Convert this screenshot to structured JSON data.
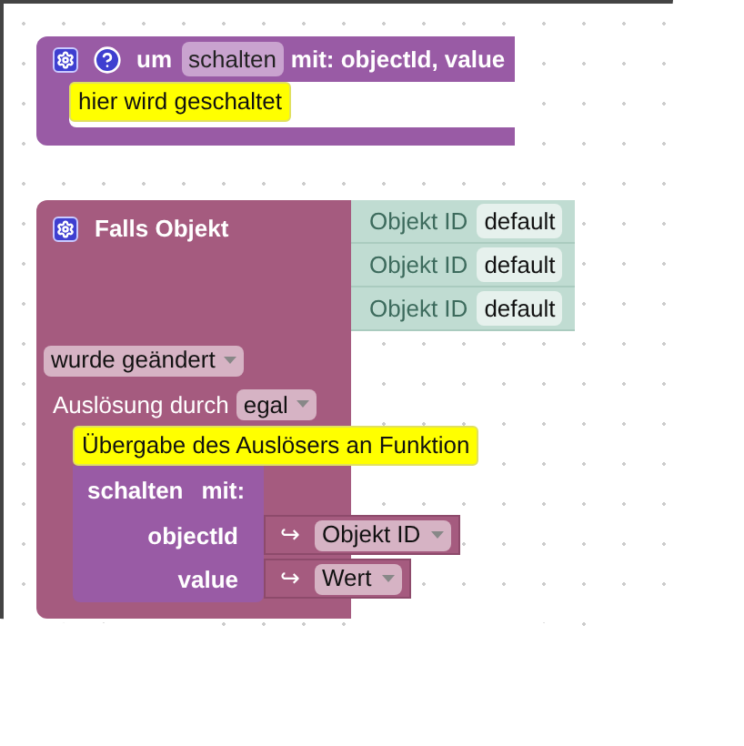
{
  "procedure_block": {
    "label_prefix": "um",
    "name": "schalten",
    "label_suffix": "mit: objectId, value",
    "comment": "hier wird geschaltet"
  },
  "trigger_block": {
    "title": "Falls Objekt",
    "object_inputs": [
      {
        "label": "Objekt ID",
        "value": "default"
      },
      {
        "label": "Objekt ID",
        "value": "default"
      },
      {
        "label": "Objekt ID",
        "value": "default"
      }
    ],
    "event_dropdown": "wurde geändert",
    "trigger_label": "Auslösung durch",
    "trigger_dropdown": "egal",
    "comment": "Übergabe des Auslösers an Funktion",
    "call_block": {
      "name": "schalten",
      "with_label": "mit:",
      "args": [
        {
          "name": "objectId",
          "arrow": "↪",
          "value": "Objekt ID"
        },
        {
          "name": "value",
          "arrow": "↪",
          "value": "Wert"
        }
      ]
    }
  }
}
